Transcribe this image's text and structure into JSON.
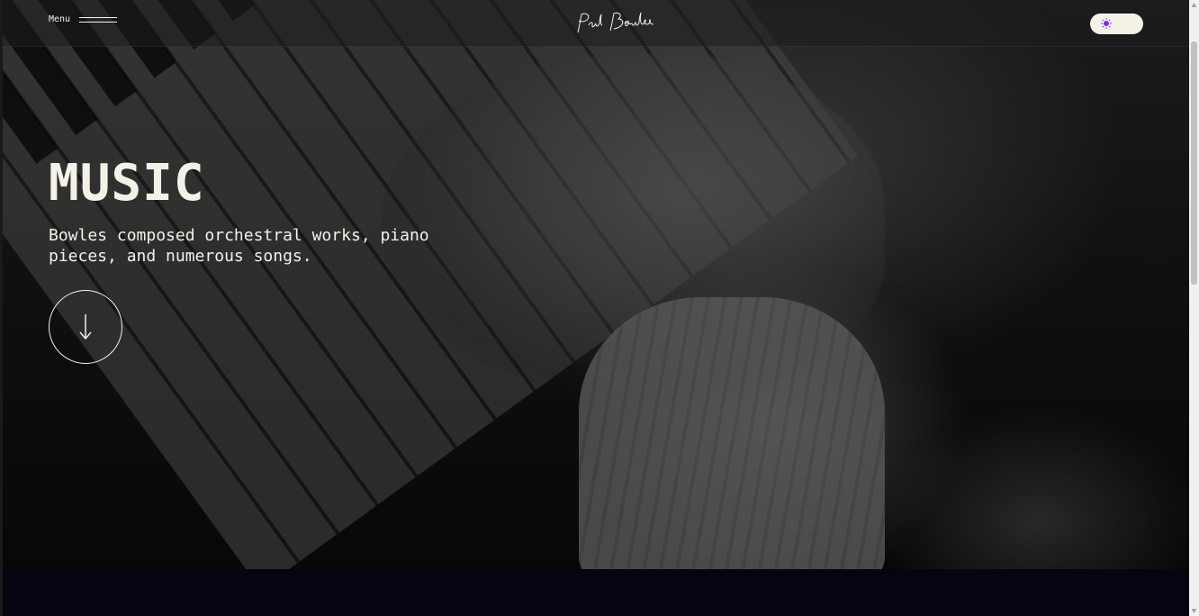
{
  "header": {
    "menu_label": "Menu",
    "logo_text": "Paul Bowles",
    "theme_toggle_icon": "sun-icon"
  },
  "hero": {
    "title": "MUSIC",
    "subtitle": "Bowles composed orchestral works, piano pieces, and numerous songs.",
    "scroll_icon": "arrow-down-icon"
  },
  "colors": {
    "text": "#f4f1e6",
    "accent": "#7a2cff",
    "bottom_section": "#060411"
  }
}
